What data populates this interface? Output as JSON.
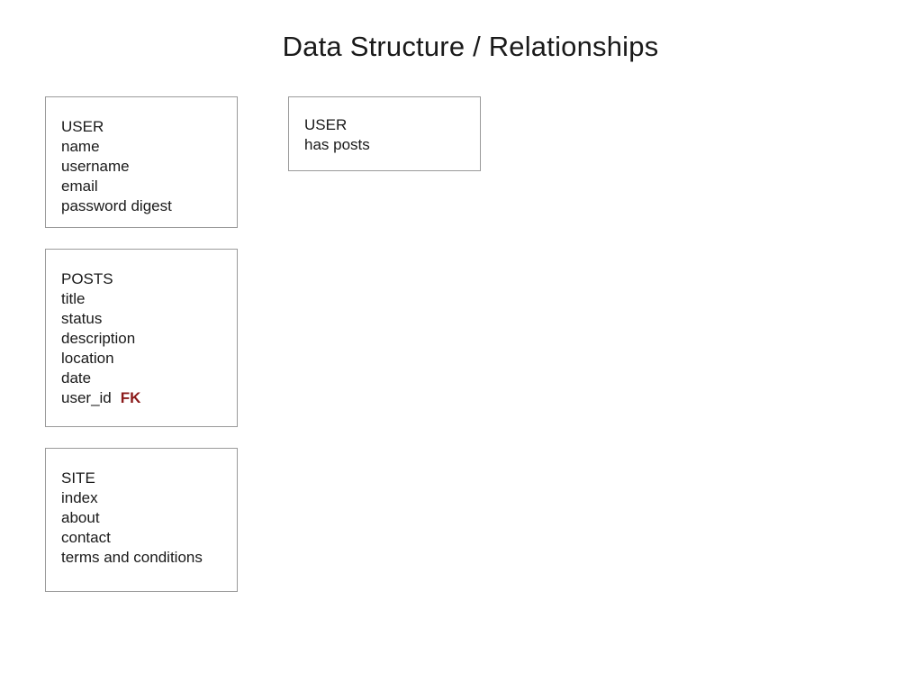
{
  "title": "Data Structure / Relationships",
  "entities": {
    "user": {
      "name": "USER",
      "fields": [
        "name",
        "username",
        "email",
        "password digest"
      ]
    },
    "posts": {
      "name": "POSTS",
      "fields": [
        "title",
        "status",
        "description",
        "location",
        "date"
      ],
      "fk_field": "user_id",
      "fk_label": "FK"
    },
    "site": {
      "name": "SITE",
      "fields": [
        "index",
        "about",
        "contact",
        "terms and conditions"
      ]
    }
  },
  "relationships": {
    "user": {
      "name": "USER",
      "relation": "has posts"
    }
  },
  "colors": {
    "fk": "#8b1a1a",
    "border": "#9a9a9a"
  }
}
